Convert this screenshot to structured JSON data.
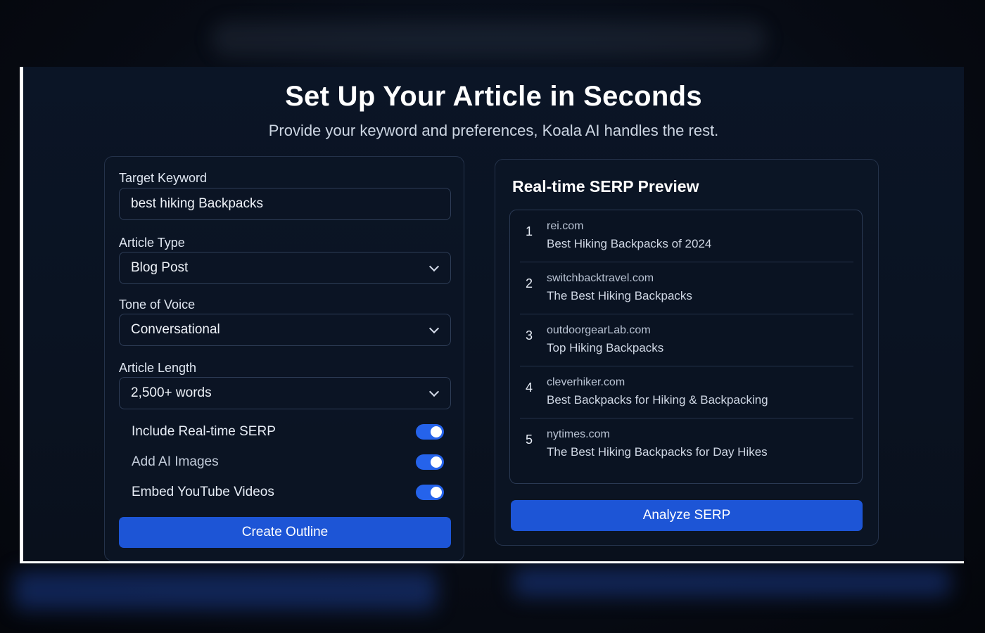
{
  "page": {
    "title": "Set Up Your Article in Seconds",
    "subtitle": "Provide your keyword and preferences, Koala AI handles the rest."
  },
  "form": {
    "keyword": {
      "label": "Target Keyword",
      "value": "best hiking Backpacks"
    },
    "article_type": {
      "label": "Article Type",
      "value": "Blog Post"
    },
    "tone": {
      "label": "Tone of Voice",
      "value": "Conversational"
    },
    "length": {
      "label": "Article Length",
      "value": "2,500+ words"
    },
    "toggles": [
      {
        "label": "Include Real-time SERP",
        "enabled": true
      },
      {
        "label": "Add AI Images",
        "enabled": true
      },
      {
        "label": "Embed YouTube Videos",
        "enabled": true
      }
    ],
    "submit_label": "Create Outline"
  },
  "serp": {
    "title": "Real-time SERP Preview",
    "results": [
      {
        "rank": "1",
        "domain": "rei.com",
        "headline": "Best Hiking Backpacks of 2024"
      },
      {
        "rank": "2",
        "domain": "switchbacktravel.com",
        "headline": "The Best Hiking Backpacks"
      },
      {
        "rank": "3",
        "domain": "outdoorgearLab.com",
        "headline": "Top Hiking Backpacks"
      },
      {
        "rank": "4",
        "domain": "cleverhiker.com",
        "headline": "Best Backpacks for Hiking & Backpacking"
      },
      {
        "rank": "5",
        "domain": "nytimes.com",
        "headline": "The Best Hiking Backpacks for Day Hikes"
      }
    ],
    "analyze_label": "Analyze SERP"
  },
  "colors": {
    "accent": "#1d55d6",
    "toggle_on": "#2563eb",
    "panel_bg": "#0b1526"
  }
}
